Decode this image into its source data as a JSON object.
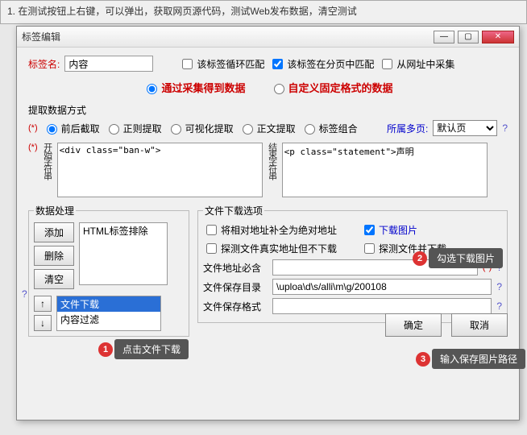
{
  "bg": {
    "hint": "1. 在测试按钮上右键，可以弹出，获取网页源代码，测试Web发布数据，清空测试"
  },
  "dialog": {
    "title": "标签编辑",
    "tagname_label": "标签名:",
    "tagname_value": "内容",
    "loop_match": "该标签循环匹配",
    "page_match": "该标签在分页中匹配",
    "url_collect": "从网址中采集",
    "via_collect": "通过采集得到数据",
    "custom_fixed": "自定义固定格式的数据",
    "extract_label": "提取数据方式",
    "r_frontback": "前后截取",
    "r_regex": "正则提取",
    "r_visual": "可视化提取",
    "r_body": "正文提取",
    "r_combo": "标签组合",
    "belong_label": "所属多页:",
    "belong_value": "默认页",
    "start_label": "开始字符串",
    "start_value": "<div class=\"ban-w\">",
    "end_label": "结束字符串",
    "end_value": "<p class=\"statement\">声明",
    "proc": {
      "legend": "数据处理",
      "add": "添加",
      "del": "删除",
      "clear": "清空",
      "list_top": "HTML标签排除",
      "list_sel": "文件下载",
      "list_last": "内容过滤"
    },
    "dl": {
      "legend": "文件下载选项",
      "abs_url": "将相对地址补全为绝对地址",
      "probe_nodl": "探测文件真实地址但不下载",
      "dl_img": "下载图片",
      "probe_dl": "探测文件并下载",
      "addr_must": "文件地址必含",
      "addr_val": "",
      "save_dir": "文件保存目录",
      "save_dir_val": "\\uploa\\d\\s/alli\\m\\g/200108",
      "save_fmt": "文件保存格式",
      "save_fmt_val": ""
    },
    "ok": "确定",
    "cancel": "取消",
    "star": "(*)",
    "help": "?"
  },
  "callouts": {
    "c1": "点击文件下载",
    "c2": "勾选下载图片",
    "c3": "输入保存图片路径"
  }
}
